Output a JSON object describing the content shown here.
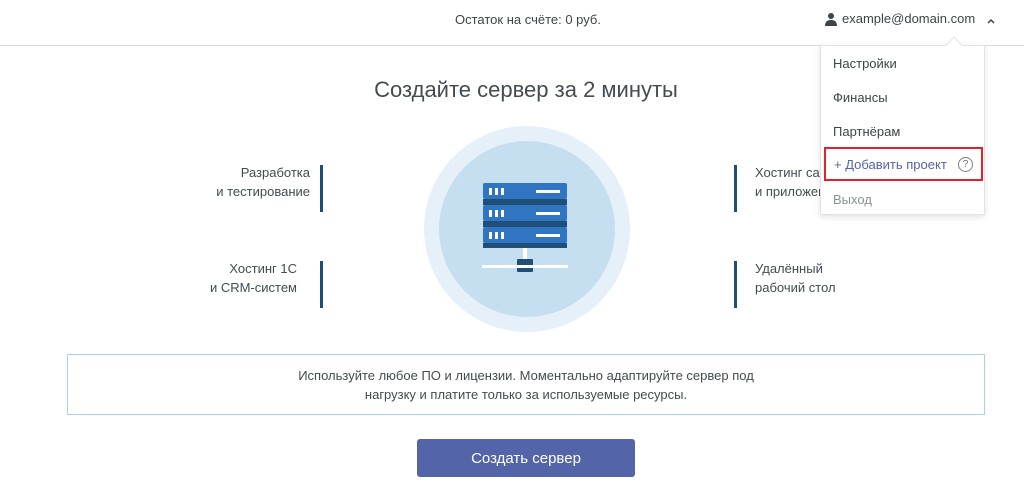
{
  "header": {
    "balance_text": "Остаток на счёте: 0 руб.",
    "user_email": "example@domain.com"
  },
  "main": {
    "title": "Создайте сервер за 2 минуты",
    "features": [
      {
        "line1": "Разработка",
        "line2": "и тестирование"
      },
      {
        "line1": "Хостинг сайтов",
        "line2": "и приложений"
      },
      {
        "line1": "Хостинг 1С",
        "line2": "и CRM-систем"
      },
      {
        "line1": "Удалённый",
        "line2": "рабочий стол"
      }
    ],
    "info_text": "Используйте любое ПО и лицензии. Моментально адаптируйте сервер под нагрузку и платите только за используемые ресурсы.",
    "create_button_label": "Создать сервер"
  },
  "dropdown": {
    "items": [
      {
        "label": "Настройки"
      },
      {
        "label": "Финансы"
      },
      {
        "label": "Партнёрам"
      },
      {
        "label": "+ Добавить проект",
        "help": "?"
      },
      {
        "label": "Выход"
      }
    ]
  },
  "colors": {
    "accent": "#5365a8",
    "feature_bar": "#1f4e79",
    "highlight_border": "#e2212b",
    "server_blue": "#2f75c1",
    "circle_outer": "#e6f0f8",
    "circle_inner": "#c5dff0"
  }
}
